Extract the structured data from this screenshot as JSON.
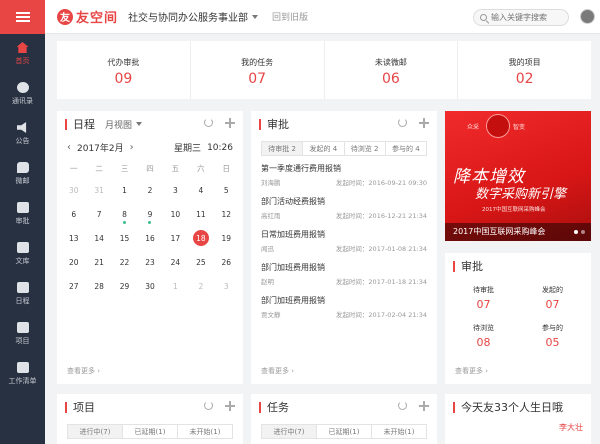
{
  "header": {
    "logo_mark": "友",
    "logo_text": "友空间",
    "department": "社交与协同办公服务事业部",
    "back_to_old": "回到旧版",
    "search_placeholder": "输入关键字搜索"
  },
  "sidebar": {
    "items": [
      {
        "label": "首页",
        "icon": "home-icon",
        "active": true
      },
      {
        "label": "通讯录",
        "icon": "contacts-icon"
      },
      {
        "label": "公告",
        "icon": "speaker-icon"
      },
      {
        "label": "微邮",
        "icon": "mail-icon"
      },
      {
        "label": "审批",
        "icon": "approval-icon"
      },
      {
        "label": "文库",
        "icon": "library-icon"
      },
      {
        "label": "日程",
        "icon": "calendar-icon"
      },
      {
        "label": "项目",
        "icon": "project-icon"
      },
      {
        "label": "工作清单",
        "icon": "worklist-icon"
      }
    ]
  },
  "stats": [
    {
      "label": "代办审批",
      "value": "09"
    },
    {
      "label": "我的任务",
      "value": "07"
    },
    {
      "label": "未读微邮",
      "value": "06"
    },
    {
      "label": "我的项目",
      "value": "02"
    }
  ],
  "calendar": {
    "title": "日程",
    "view": "月视图",
    "prev": "‹",
    "next": "›",
    "month": "2017年2月",
    "weekday": "星期三",
    "time": "10:26",
    "weekdays": [
      "一",
      "二",
      "三",
      "四",
      "五",
      "六",
      "日"
    ],
    "days": [
      {
        "d": "30",
        "m": true
      },
      {
        "d": "31",
        "m": true
      },
      {
        "d": "1"
      },
      {
        "d": "2"
      },
      {
        "d": "3"
      },
      {
        "d": "4"
      },
      {
        "d": "5"
      },
      {
        "d": "6"
      },
      {
        "d": "7"
      },
      {
        "d": "8",
        "dot": true
      },
      {
        "d": "9",
        "dot": true
      },
      {
        "d": "10"
      },
      {
        "d": "11"
      },
      {
        "d": "12"
      },
      {
        "d": "13"
      },
      {
        "d": "14"
      },
      {
        "d": "15"
      },
      {
        "d": "16"
      },
      {
        "d": "17"
      },
      {
        "d": "18",
        "today": true
      },
      {
        "d": "19"
      },
      {
        "d": "20"
      },
      {
        "d": "21"
      },
      {
        "d": "22"
      },
      {
        "d": "23"
      },
      {
        "d": "24"
      },
      {
        "d": "25"
      },
      {
        "d": "26"
      },
      {
        "d": "27"
      },
      {
        "d": "28"
      },
      {
        "d": "29"
      },
      {
        "d": "30"
      },
      {
        "d": "1",
        "m": true
      },
      {
        "d": "2",
        "m": true
      },
      {
        "d": "3",
        "m": true
      }
    ],
    "more": "查看更多 ›"
  },
  "approval": {
    "title": "审批",
    "tabs": [
      "待审批 2",
      "发起的 4",
      "待浏览 2",
      "参与的 4"
    ],
    "items": [
      {
        "title": "第一季度通行费用报销",
        "name": "刘海鹏",
        "time": "发起时间：2016-09-21 09:30"
      },
      {
        "title": "部门活动经费报销",
        "name": "高红雨",
        "time": "发起时间：2016-12-21 21:34"
      },
      {
        "title": "日常加班费用报销",
        "name": "闻迅",
        "time": "发起时间：2017-01-08 21:34"
      },
      {
        "title": "部门加班费用报销",
        "name": "赵明",
        "time": "发起时间：2017-01-18 21:34"
      },
      {
        "title": "部门加班费用报销",
        "name": "贾文静",
        "time": "发起时间：2017-02-04 21:34"
      }
    ],
    "more": "查看更多 ›"
  },
  "banner": {
    "brand_left": "众采",
    "brand_right": "智变",
    "headline1": "降本增效",
    "headline2": "数字采购新引擎",
    "headline3": "2017中国互联网采购峰会",
    "caption": "2017中国互联网采购峰会"
  },
  "approval_right": {
    "title": "审批",
    "cells": [
      {
        "label": "待审批",
        "value": "07"
      },
      {
        "label": "发起的",
        "value": "07"
      },
      {
        "label": "待浏览",
        "value": "08"
      },
      {
        "label": "参与的",
        "value": "05"
      }
    ],
    "more": "查看更多 ›"
  },
  "bottom": {
    "project_title": "项目",
    "project_tabs": [
      "进行中(7)",
      "已延期(1)",
      "未开始(1)"
    ],
    "task_title": "任务",
    "task_tabs": [
      "进行中(7)",
      "已延期(1)",
      "未开始(1)"
    ],
    "birthday_title": "今天友33个人生日哦",
    "birthday_name": "李大壮"
  },
  "colors": {
    "accent": "#e84545",
    "sidebar": "#273142",
    "dot": "#3bbf8c"
  }
}
